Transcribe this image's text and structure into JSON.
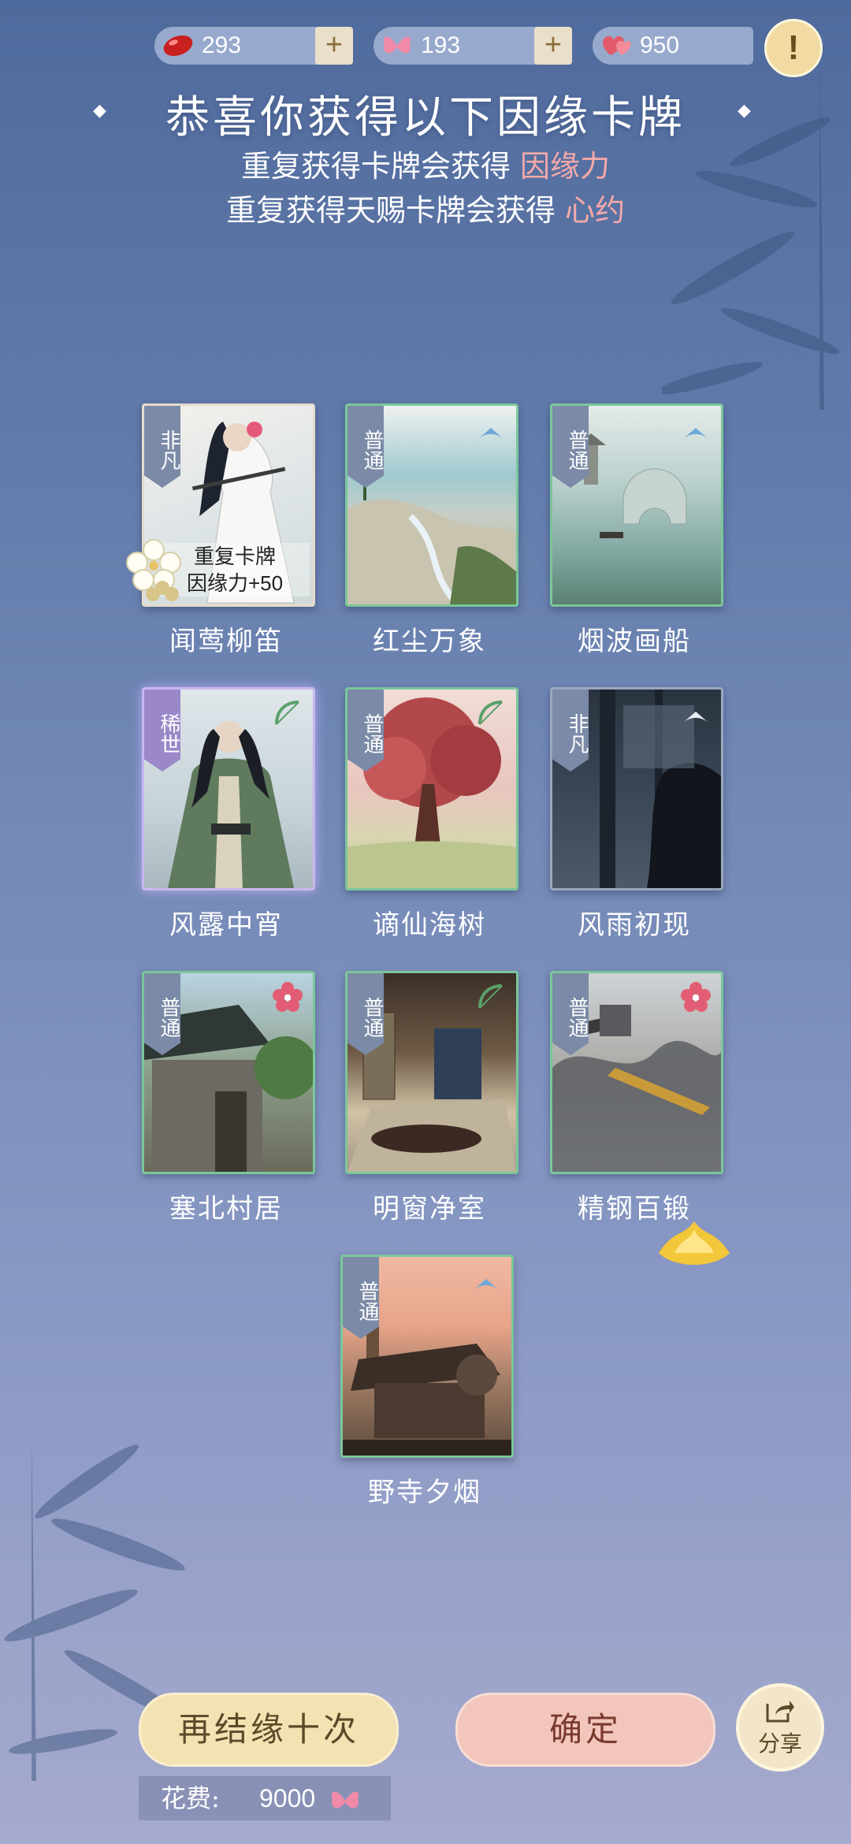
{
  "currency": {
    "jade": "293",
    "butterfly": "193",
    "hearts": "950"
  },
  "header": {
    "title": "恭喜你获得以下因缘卡牌",
    "line1": "重复获得卡牌会获得",
    "line1_highlight": "因缘力",
    "line2": "重复获得天赐卡牌会获得",
    "line2_highlight": "心约"
  },
  "cards": [
    {
      "name": "闻莺柳笛",
      "rarity": "非凡",
      "dup_line1": "重复卡牌",
      "dup_line2": "因缘力+50"
    },
    {
      "name": "红尘万象",
      "rarity": "普通"
    },
    {
      "name": "烟波画船",
      "rarity": "普通"
    },
    {
      "name": "风露中宵",
      "rarity": "稀世"
    },
    {
      "name": "谪仙海树",
      "rarity": "普通"
    },
    {
      "name": "风雨初现",
      "rarity": "非凡"
    },
    {
      "name": "塞北村居",
      "rarity": "普通"
    },
    {
      "name": "明窗净室",
      "rarity": "普通"
    },
    {
      "name": "精钢百锻",
      "rarity": "普通"
    },
    {
      "name": "野寺夕烟",
      "rarity": "普通"
    }
  ],
  "footer": {
    "again_label": "再结缘十次",
    "confirm_label": "确定",
    "share_label": "分享",
    "cost_label": "花费:",
    "cost_value": "9000"
  },
  "colors": {
    "accent_pink": "#f5a9a9",
    "common_border": "#7ac79a",
    "rare_glow": "#c9b7ee"
  }
}
